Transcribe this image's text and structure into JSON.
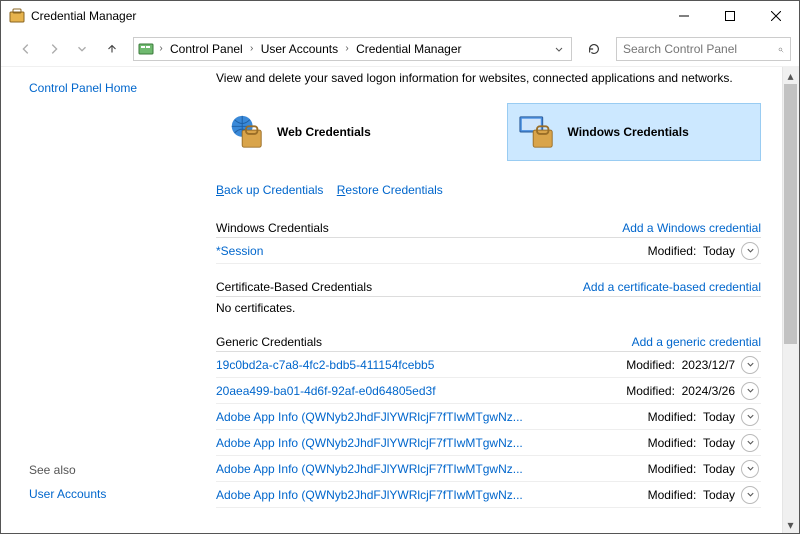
{
  "title": "Credential Manager",
  "breadcrumb": {
    "items": [
      "Control Panel",
      "User Accounts",
      "Credential Manager"
    ]
  },
  "search": {
    "placeholder": "Search Control Panel"
  },
  "sidebar": {
    "home": "Control Panel Home",
    "see_also": "See also",
    "user_accounts": "User Accounts"
  },
  "main": {
    "subtitle": "View and delete your saved logon information for websites, connected applications and networks.",
    "tab_web": "Web Credentials",
    "tab_windows": "Windows Credentials",
    "backup": "Back up Credentials",
    "restore": "Restore Credentials",
    "sections": {
      "windows": {
        "title": "Windows Credentials",
        "add": "Add a Windows credential",
        "rows": [
          {
            "name": "*Session",
            "mod_label": "Modified:",
            "mod_value": "Today"
          }
        ]
      },
      "cert": {
        "title": "Certificate-Based Credentials",
        "add": "Add a certificate-based credential",
        "empty": "No certificates."
      },
      "generic": {
        "title": "Generic Credentials",
        "add": "Add a generic credential",
        "rows": [
          {
            "name": "19c0bd2a-c7a8-4fc2-bdb5-411154fcebb5",
            "mod_label": "Modified:",
            "mod_value": "2023/12/7"
          },
          {
            "name": "20aea499-ba01-4d6f-92af-e0d64805ed3f",
            "mod_label": "Modified:",
            "mod_value": "2024/3/26"
          },
          {
            "name": "Adobe App Info (QWNyb2JhdFJlYWRlcjF7fTIwMTgwNz...",
            "mod_label": "Modified:",
            "mod_value": "Today"
          },
          {
            "name": "Adobe App Info (QWNyb2JhdFJlYWRlcjF7fTIwMTgwNz...",
            "mod_label": "Modified:",
            "mod_value": "Today"
          },
          {
            "name": "Adobe App Info (QWNyb2JhdFJlYWRlcjF7fTIwMTgwNz...",
            "mod_label": "Modified:",
            "mod_value": "Today"
          },
          {
            "name": "Adobe App Info (QWNyb2JhdFJlYWRlcjF7fTIwMTgwNz...",
            "mod_label": "Modified:",
            "mod_value": "Today"
          }
        ]
      }
    }
  }
}
